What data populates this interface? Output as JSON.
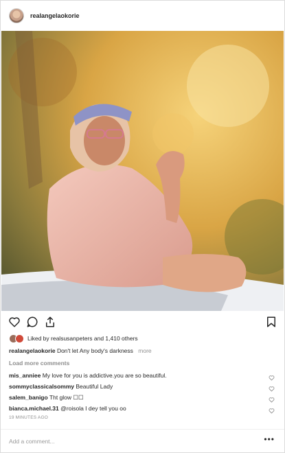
{
  "post": {
    "username": "realangelaokorie",
    "likes_text": "Liked by realsusanpeters and 1,410 others",
    "caption_user": "realangelaokorie",
    "caption_text": "Don't let Any body's darkness",
    "more_label": "more",
    "load_more": "Load more comments",
    "timestamp": "19 MINUTES AGO",
    "add_comment_placeholder": "Add a comment...",
    "options_label": "•••"
  },
  "comments": [
    {
      "user": "mis_anniee",
      "text": "My love for you is addictive.you are so beautiful."
    },
    {
      "user": "sommyclassicalsommy",
      "text": "Beautiful Lady"
    },
    {
      "user": "salem_banigo",
      "text": "Tht glow ☐☐"
    },
    {
      "user": "bianca.michael.31",
      "text": "@roisola I dey tell you oo"
    }
  ],
  "icons": [
    "heart-icon",
    "comment-icon",
    "share-icon",
    "bookmark-icon"
  ]
}
